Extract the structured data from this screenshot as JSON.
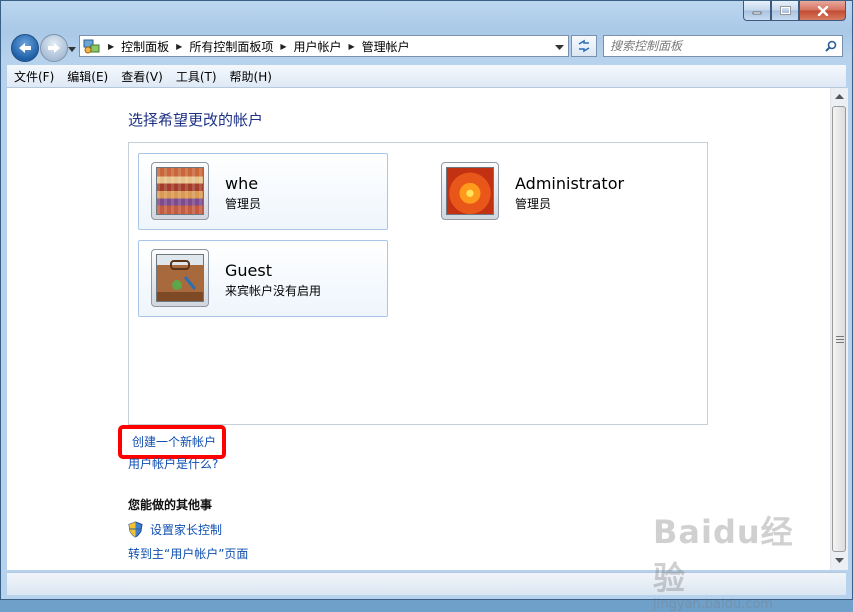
{
  "address": {
    "crumbs": [
      "控制面板",
      "所有控制面板项",
      "用户帐户",
      "管理帐户"
    ]
  },
  "search": {
    "placeholder": "搜索控制面板"
  },
  "menu": [
    "文件(F)",
    "编辑(E)",
    "查看(V)",
    "工具(T)",
    "帮助(H)"
  ],
  "main": {
    "title": "选择希望更改的帐户",
    "accounts": [
      {
        "name": "whe",
        "role": "管理员",
        "icon": "fabric-avatar-icon"
      },
      {
        "name": "Administrator",
        "role": "管理员",
        "icon": "flower-avatar-icon"
      },
      {
        "name": "Guest",
        "role": "来宾帐户没有启用",
        "icon": "suitcase-avatar-icon"
      }
    ],
    "create_link": "创建一个新帐户",
    "what_link": "用户帐户是什么?",
    "other_heading": "您能做的其他事",
    "parental_link": "设置家长控制",
    "goto_link": "转到主“用户帐户”页面"
  },
  "watermark": {
    "logo": "Baidu经验",
    "url": "jingyan.baidu.com"
  },
  "colors": {
    "title": "#1e3287",
    "link": "#0f4fb0",
    "highlight": "#ff0000",
    "card_border": "#a9c6e6"
  }
}
